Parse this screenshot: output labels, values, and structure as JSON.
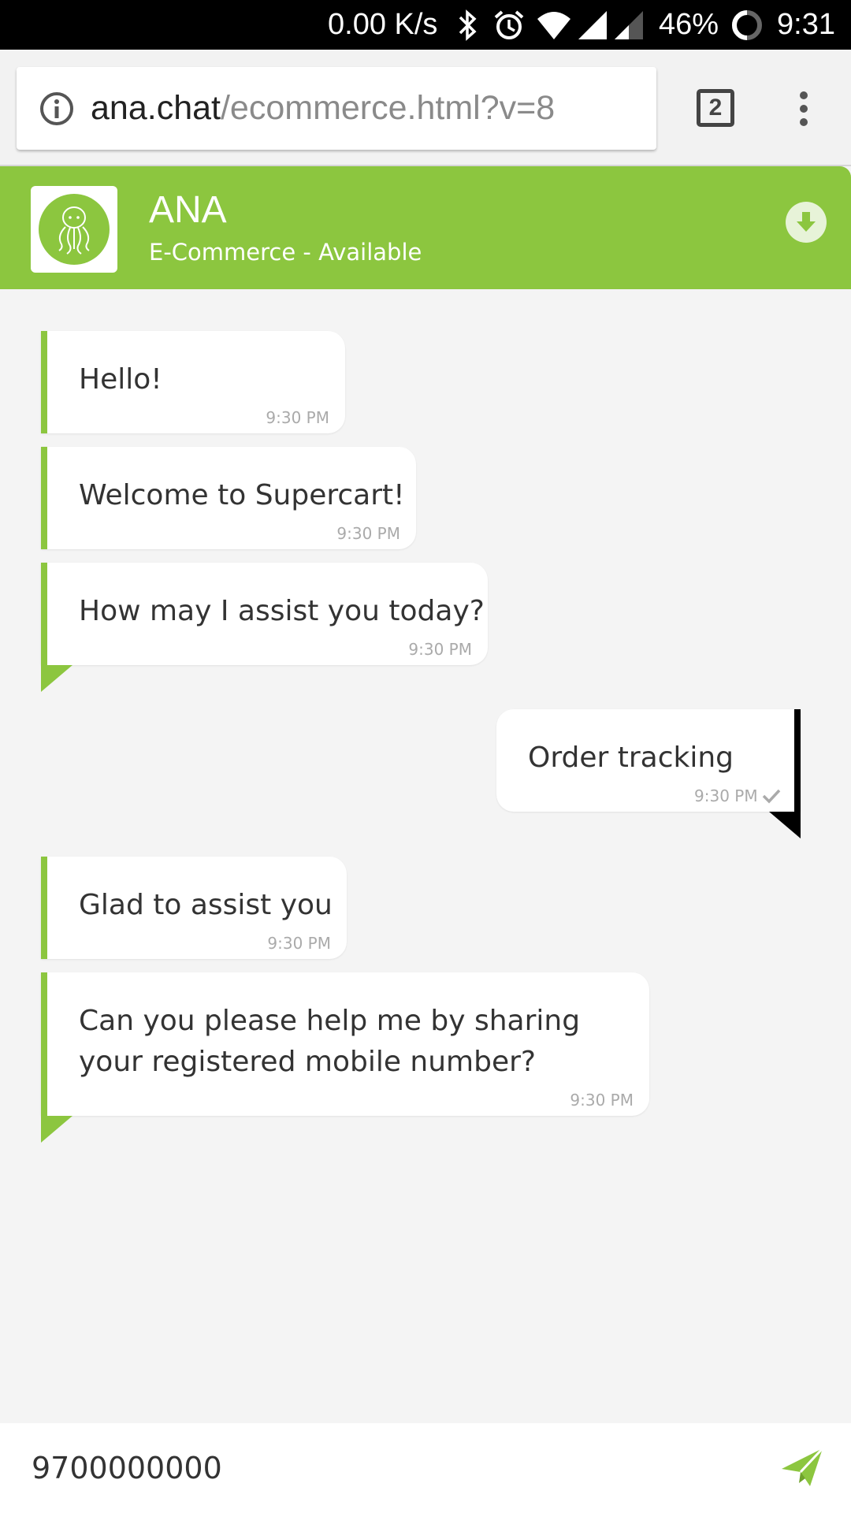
{
  "status_bar": {
    "net_speed": "0.00 K/s",
    "battery": "46%",
    "time": "9:31"
  },
  "browser": {
    "url_host": "ana.chat",
    "url_path": "/ecommerce.html?v=8",
    "tab_count": "2"
  },
  "chat_header": {
    "bot_name": "ANA",
    "status": "E-Commerce - Available"
  },
  "messages": [
    {
      "sender": "bot",
      "text": "Hello!",
      "time": "9:30 PM"
    },
    {
      "sender": "bot",
      "text": "Welcome to Supercart!",
      "time": "9:30 PM"
    },
    {
      "sender": "bot",
      "text": "How may I assist you today?",
      "time": "9:30 PM"
    },
    {
      "sender": "user",
      "text": "Order tracking",
      "time": "9:30 PM"
    },
    {
      "sender": "bot",
      "text": "Glad to assist you",
      "time": "9:30 PM"
    },
    {
      "sender": "bot",
      "text": "Can you please help me by sharing your registered mobile number?",
      "time": "9:30 PM"
    }
  ],
  "input": {
    "value": "9700000000"
  },
  "colors": {
    "brand": "#8cc63f",
    "user_accent": "#000000"
  }
}
